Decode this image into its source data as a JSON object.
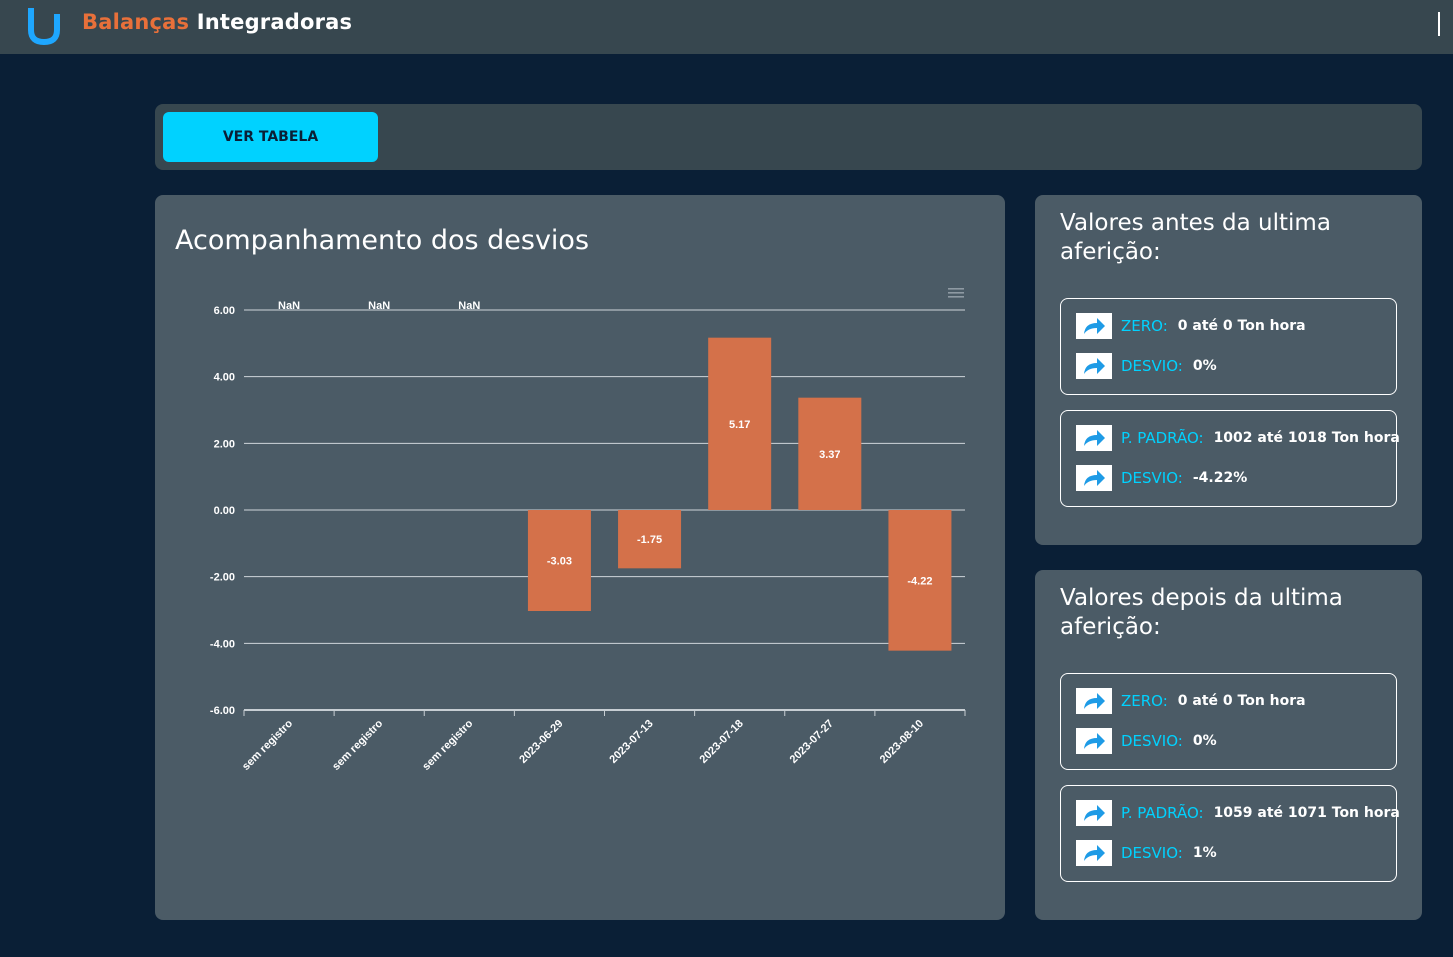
{
  "app": {
    "title_accent": "Balanças",
    "title_main": "Integradoras"
  },
  "actions": {
    "ver_tabela": "VER TABELA"
  },
  "chart": {
    "title": "Acompanhamento dos desvios"
  },
  "chart_data": {
    "type": "bar",
    "categories": [
      "sem registro",
      "sem registro",
      "sem registro",
      "2023-06-29",
      "2023-07-13",
      "2023-07-18",
      "2023-07-27",
      "2023-08-10"
    ],
    "values": [
      null,
      null,
      null,
      -3.03,
      -1.75,
      5.17,
      3.37,
      -4.22
    ],
    "data_labels": [
      "NaN",
      "NaN",
      "NaN",
      "-3.03",
      "-1.75",
      "5.17",
      "3.37",
      "-4.22"
    ],
    "yticks": [
      "6.00",
      "4.00",
      "2.00",
      "0.00",
      "-2.00",
      "-4.00",
      "-6.00"
    ],
    "ylim": [
      -6,
      6
    ],
    "grid": true,
    "bar_color": "#d4714a"
  },
  "before": {
    "title": "Valores antes da ultima aferição:",
    "box1": {
      "label1": "ZERO:",
      "value1": "0 até 0 Ton hora",
      "label2": "DESVIO:",
      "value2": "0%"
    },
    "box2": {
      "label1": "P. PADRÃO:",
      "value1": "1002 até 1018 Ton hora",
      "label2": "DESVIO:",
      "value2": "-4.22%"
    }
  },
  "after": {
    "title": "Valores depois da ultima aferição:",
    "box1": {
      "label1": "ZERO:",
      "value1": "0 até 0 Ton hora",
      "label2": "DESVIO:",
      "value2": "0%"
    },
    "box2": {
      "label1": "P. PADRÃO:",
      "value1": "1059 até 1071 Ton hora",
      "label2": "DESVIO:",
      "value2": "1%"
    }
  },
  "icons": {
    "logo": "u-logo-icon",
    "row": "share-arrow-icon",
    "chart_menu": "hamburger-menu-icon"
  },
  "colors": {
    "accent": "#00d2ff",
    "brand": "#e8703a",
    "bar": "#d4714a"
  }
}
